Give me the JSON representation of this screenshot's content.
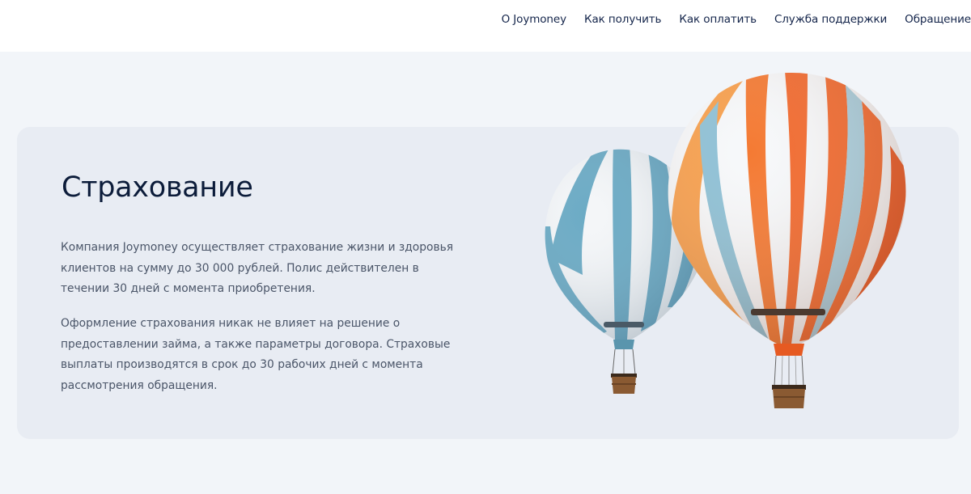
{
  "nav": {
    "items": [
      {
        "label": "О Joymoney"
      },
      {
        "label": "Как получить"
      },
      {
        "label": "Как оплатить"
      },
      {
        "label": "Служба поддержки"
      },
      {
        "label": "Обращение"
      }
    ]
  },
  "section": {
    "title": "Страхование",
    "paragraphs": [
      "Компания Joymoney осуществляет страхование жизни и здоровья клиентов на сумму до 30 000 рублей. Полис действителен в течении 30 дней с момента приобретения.",
      "Оформление страхования никак не влияет на решение о предоставлении займа, а также параметры договора.  Страховые выплаты производятся в срок до 30 рабочих дней с момента рассмотрения обращения."
    ]
  },
  "colors": {
    "nav_text": "#13244a",
    "title": "#0c1c3a",
    "body_text": "#4a5568",
    "card_bg": "#e8ecf3",
    "page_bg": "#f2f5f9",
    "balloon_blue": "#6aaac4",
    "balloon_orange": "#f26a2e"
  },
  "images": {
    "hero": "hot-air-balloons-illustration"
  }
}
